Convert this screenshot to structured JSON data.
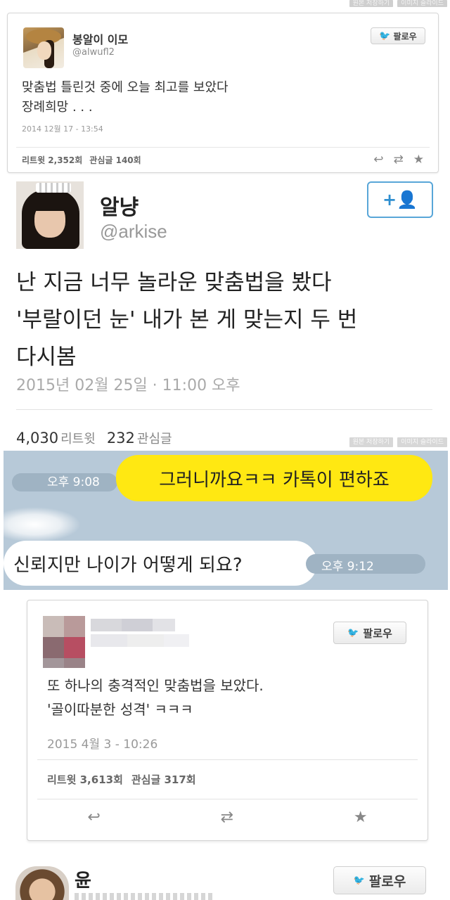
{
  "watermark": {
    "save_original": "원본 저장하기",
    "image_slide": "이미지 슬라이드"
  },
  "tweet1": {
    "name": "봉알이 이모",
    "handle": "@alwufl2",
    "follow_label": "팔로우",
    "text_lines": [
      "맞춤법 틀린것 중에 오늘 최고를  보았다",
      "장례희망 . . ."
    ],
    "timestamp": "2014 12월 17 - 13:54",
    "retweets": "리트윗 2,352회",
    "favorites": "관심글 140회",
    "actions": [
      "reply-icon",
      "retweet-icon",
      "star-icon"
    ]
  },
  "tweet2": {
    "name": "알냥",
    "handle": "@arkise",
    "follow_label": "+👤",
    "text_lines": [
      "난 지금 너무 놀라운 맞춤법을 봤다",
      "'부랄이던 눈' 내가 본 게 맞는지 두 번",
      "다시봄"
    ],
    "timestamp": "2015년 02월 25일 · 11:00 오후",
    "retweet_count": "4,030",
    "retweet_label": "리트윗",
    "favorite_count": "232",
    "favorite_label": "관심글"
  },
  "chat": {
    "msg1_time": "오후 9:08",
    "msg1_text": "그러니까요ㅋㅋ 카톡이 편하죠",
    "msg2_text": "신뢰지만 나이가 어떻게 되요?",
    "msg2_time": "오후 9:12"
  },
  "tweet3": {
    "follow_label": "팔로우",
    "text_lines": [
      "또 하나의 충격적인 맞춤법을 보았다.",
      "'골이따분한 성격' ㅋㅋㅋ"
    ],
    "timestamp": "2015 4월 3 - 10:26",
    "retweets": "리트윗 3,613회",
    "favorites": "관심글 317회"
  },
  "tweet4": {
    "name": "윤",
    "follow_label": "팔로우"
  },
  "colors": {
    "twitter_blue": "#2aa3e6",
    "kakao_yellow": "#ffe812",
    "chat_bg": "#b7c9d8"
  }
}
